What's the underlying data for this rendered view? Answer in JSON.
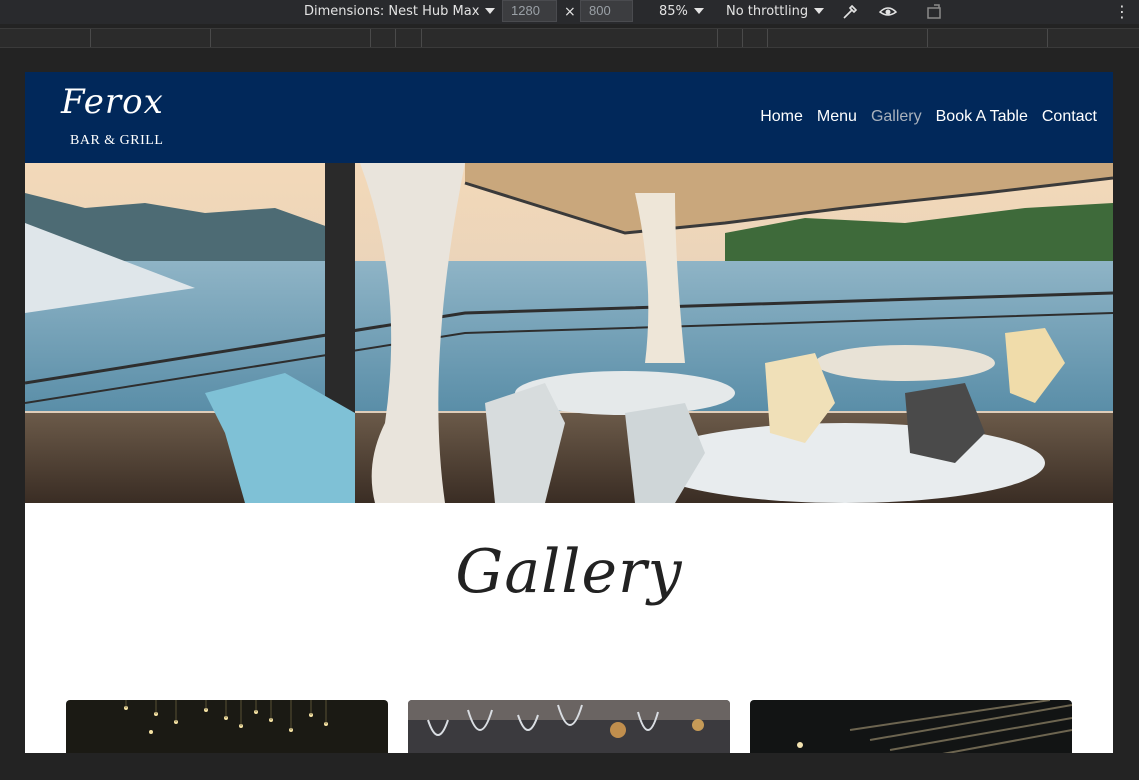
{
  "devtools": {
    "device_label": "Dimensions: Nest Hub Max",
    "width_value": "1280",
    "times": "×",
    "height_value": "800",
    "zoom": "85%",
    "throttling": "No throttling",
    "icons": [
      "eyedropper-icon",
      "eye-icon",
      "rotate-icon",
      "more-options-icon"
    ]
  },
  "site": {
    "logo_script": "Ferox",
    "logo_sub": "BAR & GRILL",
    "nav": [
      {
        "label": "Home",
        "active": false
      },
      {
        "label": "Menu",
        "active": false
      },
      {
        "label": "Gallery",
        "active": true
      },
      {
        "label": "Book A Table",
        "active": false
      },
      {
        "label": "Contact",
        "active": false
      }
    ],
    "header_color": "#01285a",
    "hero_alt": "lakeside restaurant terrace photo",
    "page_heading": "Gallery",
    "thumbnails": [
      "chandelier-lights-photo",
      "wine-glasses-photo",
      "dark-ceiling-photo"
    ]
  }
}
